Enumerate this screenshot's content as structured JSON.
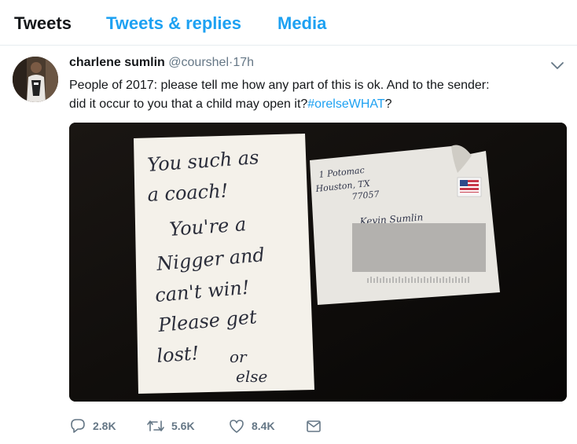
{
  "tabs": [
    {
      "label": "Tweets",
      "active": true
    },
    {
      "label": "Tweets & replies",
      "active": false
    },
    {
      "label": "Media",
      "active": false
    }
  ],
  "tweet": {
    "display_name": "charlene sumlin",
    "handle": "@courshel",
    "separator": "·",
    "time": "17h",
    "text_line1": "People of 2017: please tell me how any part of this is ok.  And to the sender:",
    "text_line2": "did it occur to you that a child may open it?",
    "hashtag": "#orelseWHAT",
    "text_end": "?",
    "media": {
      "note_lines": [
        "You such as",
        "a coach!",
        "You're a",
        "Nigger and",
        "can't win!",
        "Please get",
        "lost!"
      ],
      "note_aside": [
        "or",
        "else"
      ],
      "envelope_address": [
        "1 Potomac",
        "Houston, TX",
        "77057"
      ],
      "envelope_recipient": "Kevin Sumlin"
    },
    "actions": {
      "reply": {
        "icon": "reply-icon",
        "count": "2.8K"
      },
      "retweet": {
        "icon": "retweet-icon",
        "count": "5.6K"
      },
      "like": {
        "icon": "heart-icon",
        "count": "8.4K"
      },
      "message": {
        "icon": "envelope-icon"
      }
    }
  },
  "colors": {
    "link": "#1da1f2",
    "secondary": "#657786",
    "text": "#14171a"
  }
}
